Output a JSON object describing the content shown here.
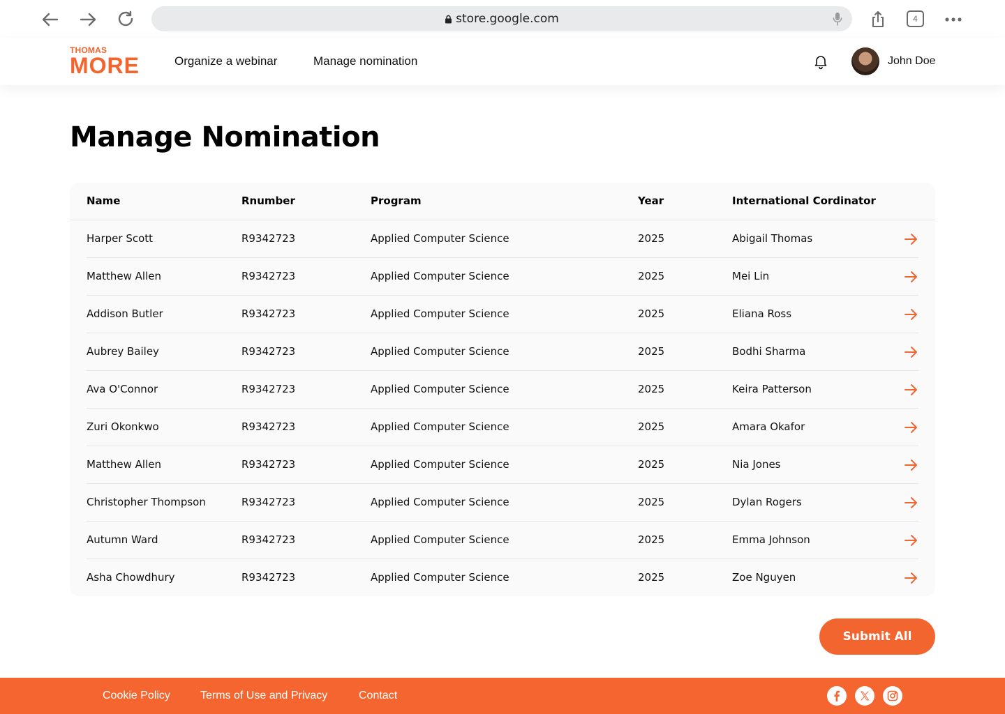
{
  "browser": {
    "url": "store.google.com",
    "tab_count": "4"
  },
  "header": {
    "logo_top": "THOMAS",
    "logo_main": "MORE",
    "nav": [
      "Organize a webinar",
      "Manage nomination"
    ],
    "user_name": "John Doe"
  },
  "main": {
    "title": "Manage Nomination",
    "columns": [
      "Name",
      "Rnumber",
      "Program",
      "Year",
      "International Cordinator"
    ],
    "rows": [
      {
        "name": "Harper Scott",
        "rnumber": "R9342723",
        "program": "Applied Computer Science",
        "year": "2025",
        "coordinator": "Abigail Thomas"
      },
      {
        "name": "Matthew Allen",
        "rnumber": "R9342723",
        "program": "Applied Computer Science",
        "year": "2025",
        "coordinator": "Mei Lin"
      },
      {
        "name": "Addison Butler",
        "rnumber": "R9342723",
        "program": "Applied Computer Science",
        "year": "2025",
        "coordinator": "Eliana Ross"
      },
      {
        "name": "Aubrey Bailey",
        "rnumber": "R9342723",
        "program": "Applied Computer Science",
        "year": "2025",
        "coordinator": "Bodhi Sharma"
      },
      {
        "name": "Ava O'Connor",
        "rnumber": "R9342723",
        "program": "Applied Computer Science",
        "year": "2025",
        "coordinator": "Keira Patterson"
      },
      {
        "name": "Zuri Okonkwo",
        "rnumber": "R9342723",
        "program": "Applied Computer Science",
        "year": "2025",
        "coordinator": "Amara Okafor"
      },
      {
        "name": "Matthew Allen",
        "rnumber": "R9342723",
        "program": "Applied Computer Science",
        "year": "2025",
        "coordinator": "Nia Jones"
      },
      {
        "name": "Christopher Thompson",
        "rnumber": "R9342723",
        "program": "Applied Computer Science",
        "year": "2025",
        "coordinator": "Dylan Rogers"
      },
      {
        "name": "Autumn Ward",
        "rnumber": "R9342723",
        "program": "Applied Computer Science",
        "year": "2025",
        "coordinator": "Emma Johnson"
      },
      {
        "name": "Asha Chowdhury",
        "rnumber": "R9342723",
        "program": "Applied Computer Science",
        "year": "2025",
        "coordinator": "Zoe Nguyen"
      }
    ],
    "submit_label": "Submit All"
  },
  "footer": {
    "links": [
      "Cookie Policy",
      "Terms of Use and Privacy",
      "Contact"
    ],
    "social_icons": [
      "facebook-icon",
      "x-icon",
      "instagram-icon"
    ]
  },
  "colors": {
    "accent": "#f2652f",
    "footer_bg": "#f56530",
    "table_bg": "#fafafa"
  }
}
